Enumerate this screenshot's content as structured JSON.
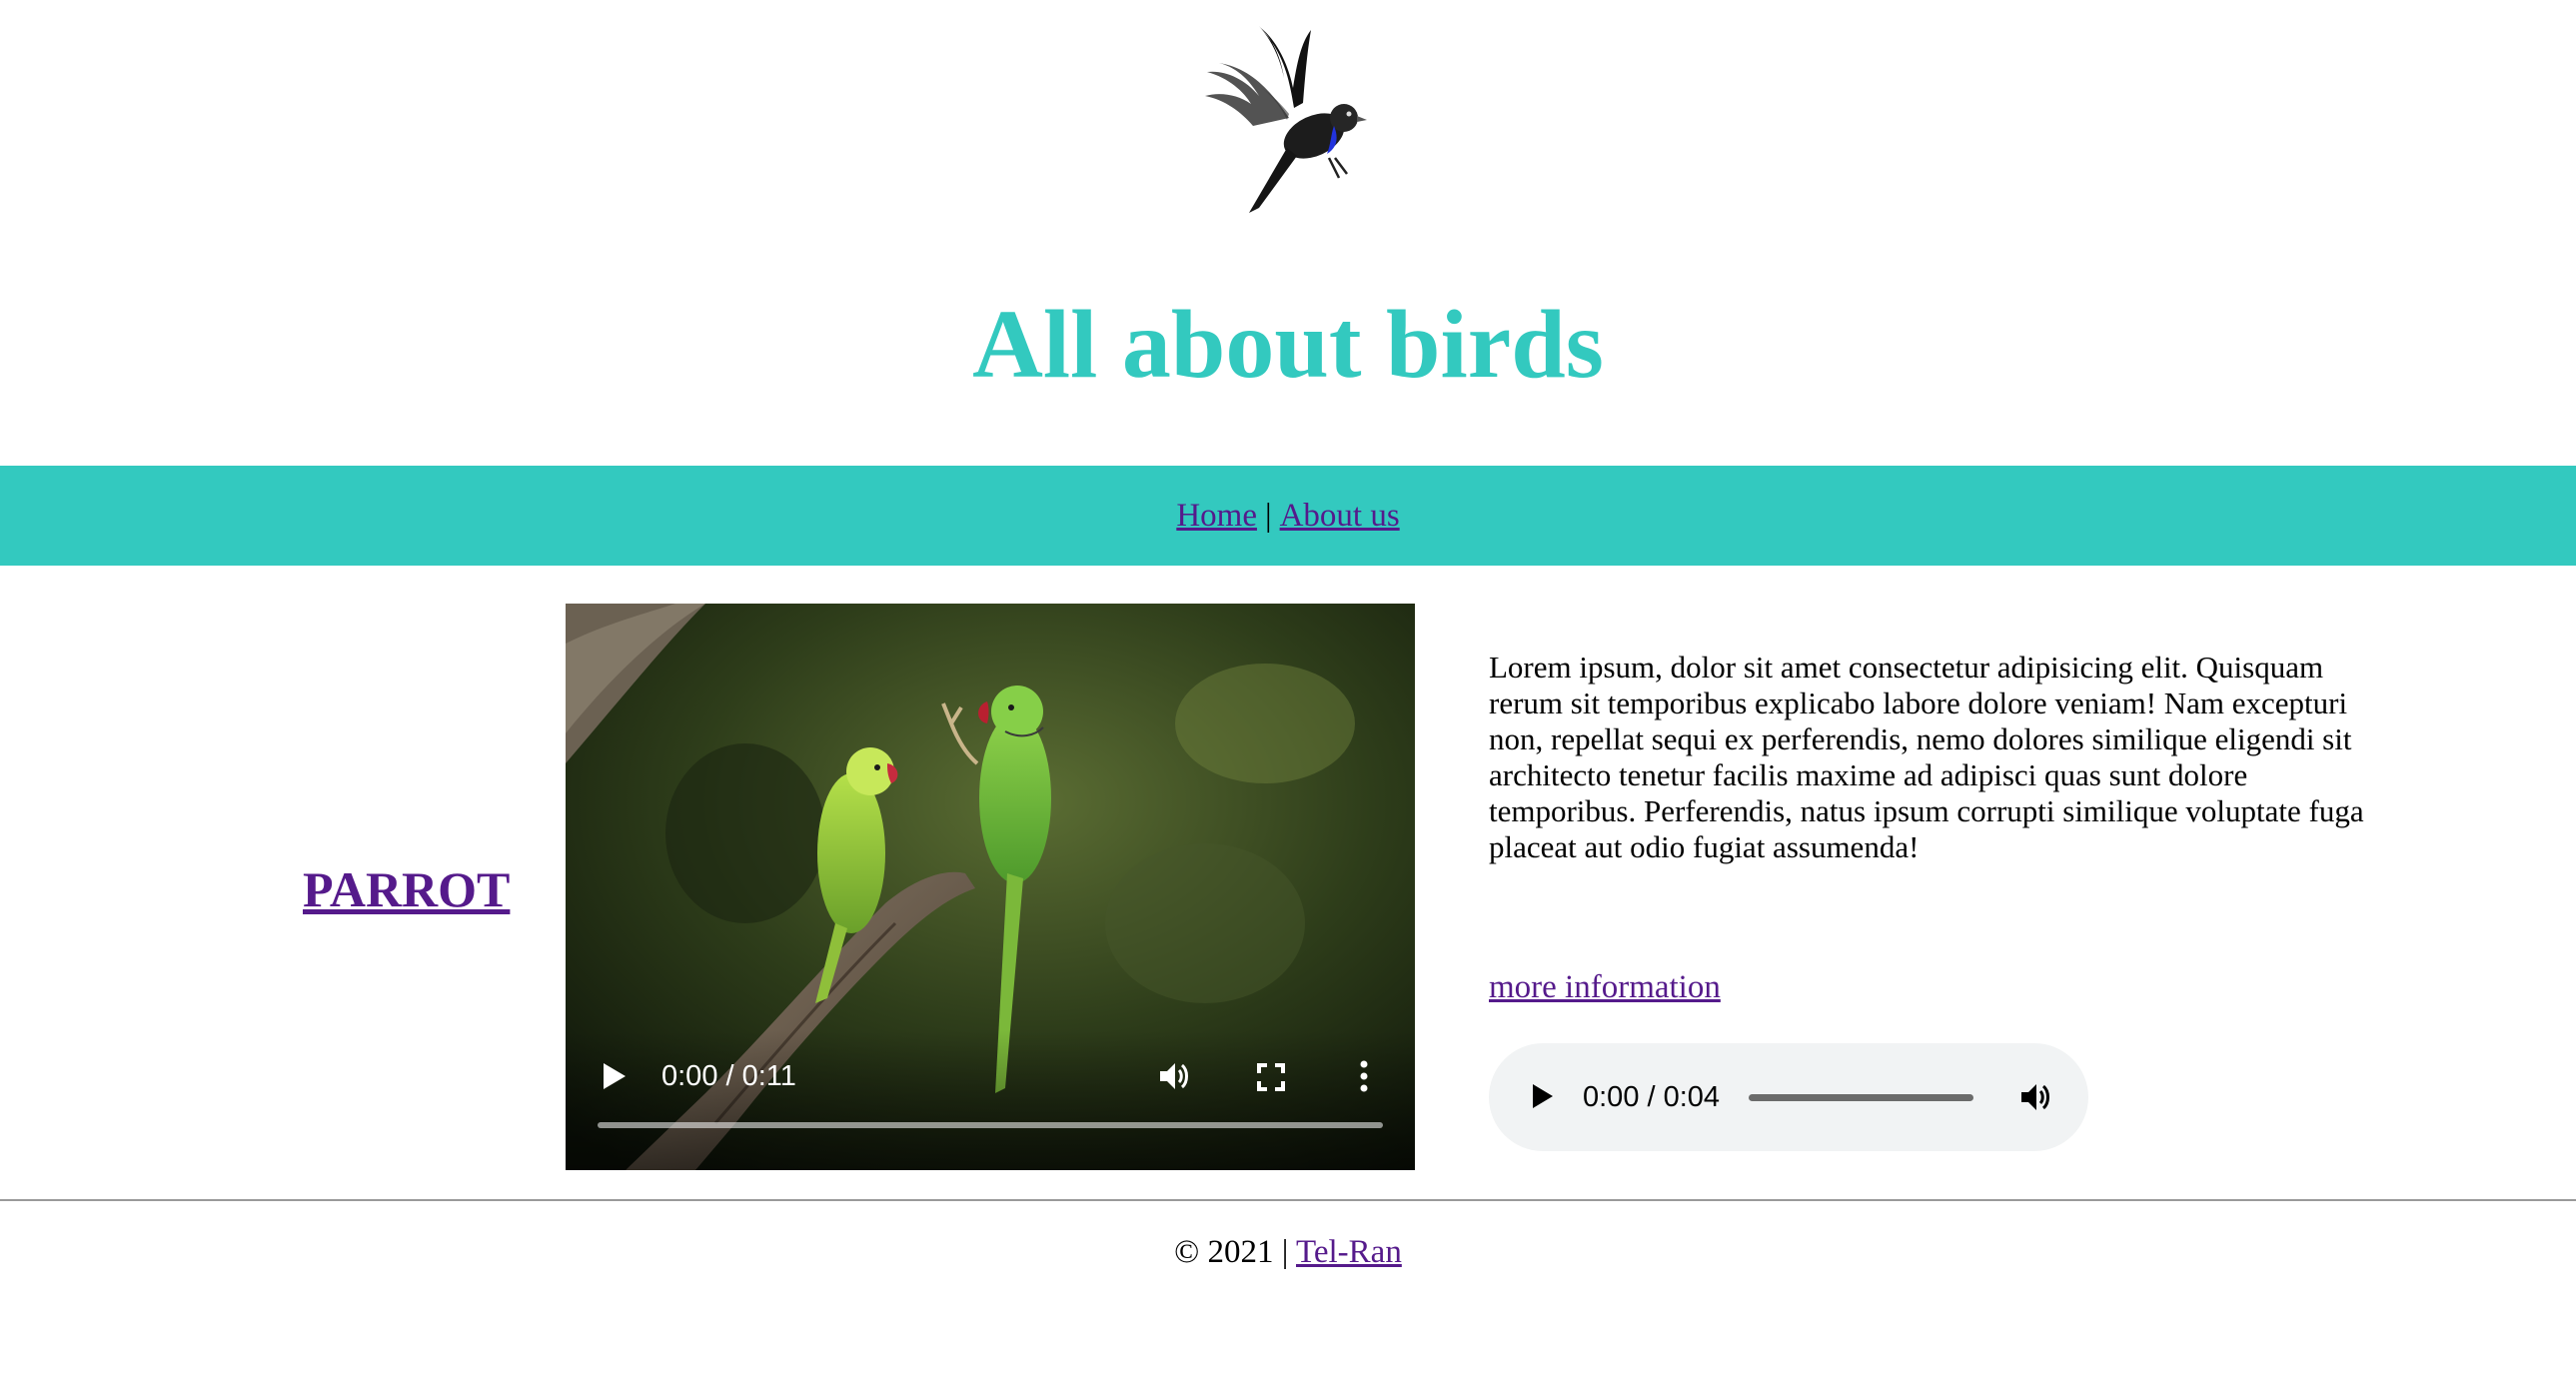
{
  "header": {
    "title": "All about birds"
  },
  "nav": {
    "items": [
      {
        "label": "Home"
      },
      {
        "label": "About us"
      }
    ],
    "separator": "|"
  },
  "main": {
    "bird_link": "PARROT",
    "video": {
      "time": "0:00 / 0:11",
      "progress": 0,
      "icons": [
        "play-icon",
        "volume-icon",
        "fullscreen-icon",
        "more-options-icon"
      ]
    },
    "description": "Lorem ipsum, dolor sit amet consectetur adipisicing elit. Quisquam rerum sit temporibus explicabo labore dolore veniam! Nam excepturi non, repellat sequi ex perferendis, nemo dolores similique eligendi sit architecto tenetur facilis maxime ad adipisci quas sunt dolore temporibus. Perferendis, natus ipsum corrupti similique voluptate fuga placeat aut odio fugiat assumenda!",
    "more_link": "more information",
    "audio": {
      "time": "0:00 / 0:04",
      "progress": 0,
      "icons": [
        "play-icon",
        "volume-icon"
      ]
    }
  },
  "footer": {
    "copyright": "© 2021 |",
    "link": "Tel-Ran"
  },
  "colors": {
    "accent": "#33c9bf",
    "link": "#551a8b",
    "audio_bg": "#f1f3f4"
  }
}
